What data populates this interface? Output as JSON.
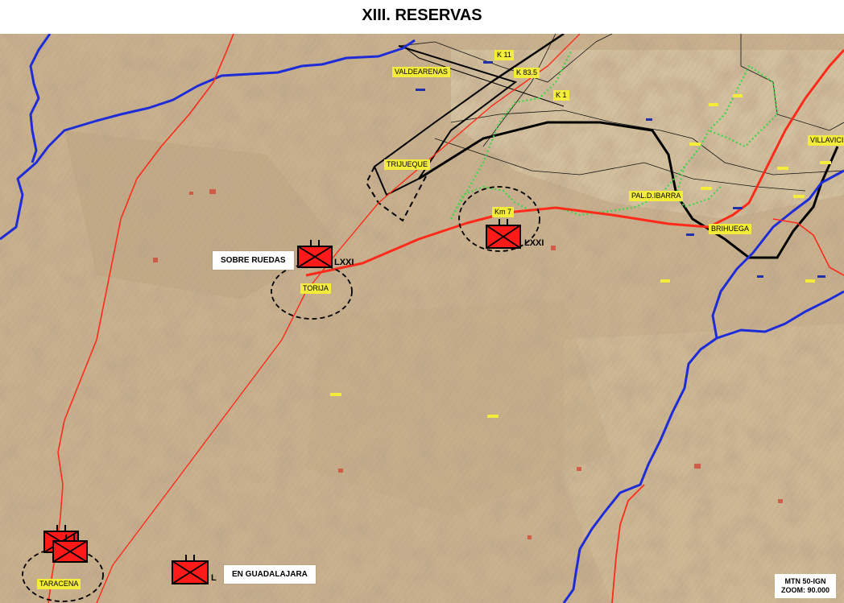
{
  "title": "XIII. RESERVAS",
  "places": {
    "valdearenas": "VALDEARENAS",
    "k11": "K 11",
    "k835": "K 83.5",
    "k1": "K 1",
    "trijueque": "TRIJUEQUE",
    "km7": "Km 7",
    "palibarra": "PAL.D.IBARRA",
    "brihuega": "BRIHUEGA",
    "villavic": "VILLAVICI",
    "torija": "TORIJA",
    "taracena": "TARACENA"
  },
  "labels": {
    "sobre_ruedas": "SOBRE RUEDAS",
    "en_guadalajara": "EN GUADALAJARA"
  },
  "echelons": {
    "torija_unit": "LXXI",
    "km7_unit": "LXXI",
    "guadalajara_unit": "L"
  },
  "source": {
    "line1": "MTN 50-IGN",
    "line2": "ZOOM: 90.000"
  },
  "colors": {
    "map_base": "#c9b18e",
    "river": "#1e2cd8",
    "road": "#ff2a1a",
    "front_green": "#38d84a",
    "unit_fill": "#ff1a1a",
    "place_label_bg": "#f4ec3a"
  }
}
